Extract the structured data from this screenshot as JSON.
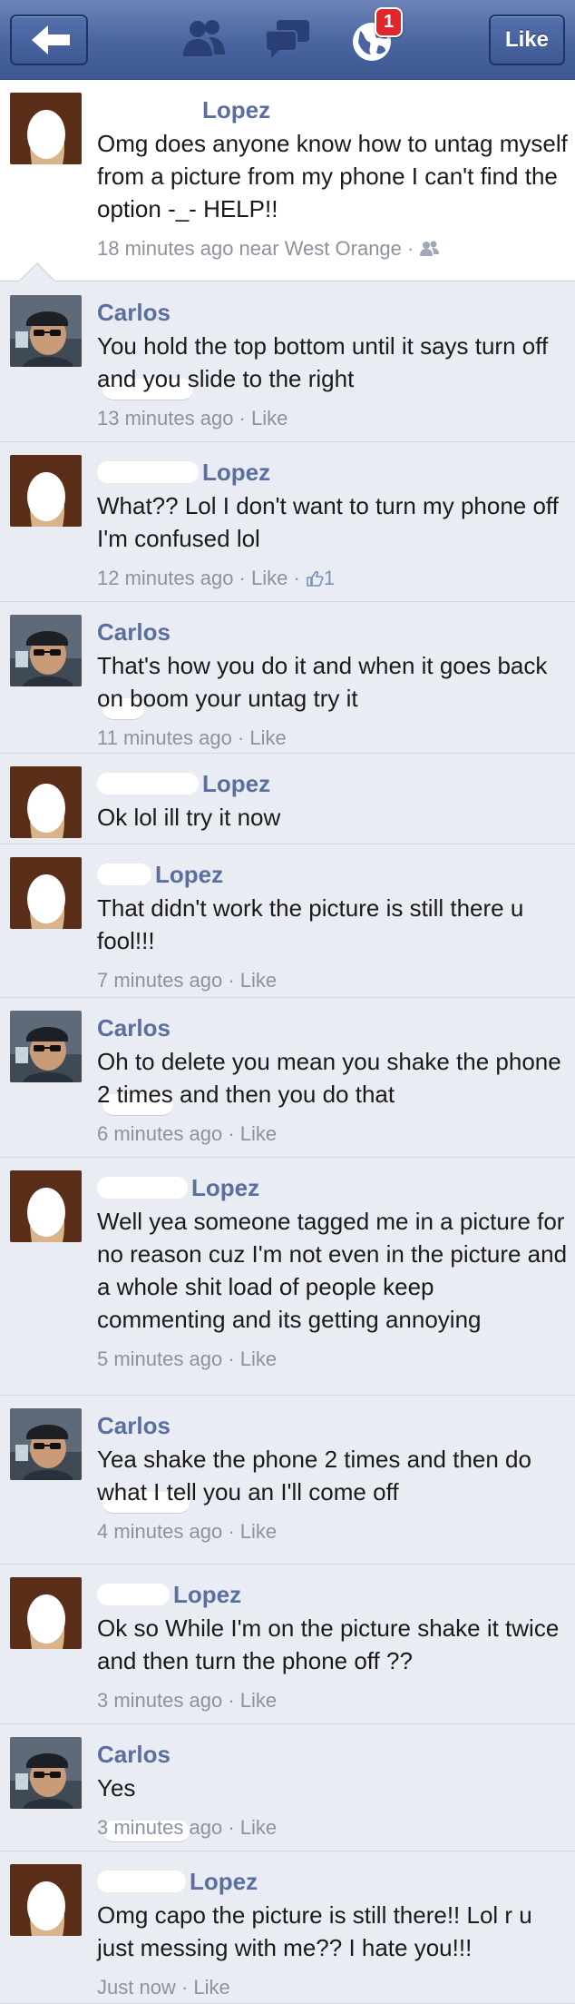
{
  "topbar": {
    "like_label": "Like",
    "notification_count": "1",
    "colors": {
      "bar": "#4a64a0",
      "badge": "#e0262b"
    }
  },
  "post": {
    "author_surname": "Lopez",
    "text": "Omg does anyone know how to untag myself from a picture from my phone I can't find the option -_- HELP!!",
    "time": "18 minutes ago near West Orange"
  },
  "comments": [
    {
      "author": "Carlos",
      "text": "You hold the top bottom until it says turn off and you slide to the right",
      "time": "13 minutes ago",
      "like": "Like"
    },
    {
      "author": "Lopez",
      "text": "What?? Lol I don't want to turn my phone off I'm confused lol",
      "time": "12 minutes ago",
      "like": "Like",
      "likes": "1"
    },
    {
      "author": "Carlos",
      "text": "That's how you do it and when it goes back on boom your untag try it",
      "time": "11 minutes ago",
      "like": "Like"
    },
    {
      "author": "Lopez",
      "text": "Ok lol ill try it now"
    },
    {
      "author": "Lopez",
      "text": "That didn't work the picture is still there u fool!!!",
      "time": "7 minutes ago",
      "like": "Like"
    },
    {
      "author": "Carlos",
      "text": "Oh to delete you mean you shake the phone 2 times and then you do that",
      "time": "6 minutes ago",
      "like": "Like"
    },
    {
      "author": "Lopez",
      "text": "Well yea someone tagged me in a picture for no reason cuz I'm not even in the picture and a whole shit load of people keep commenting and its getting annoying",
      "time": "5 minutes ago",
      "like": "Like"
    },
    {
      "author": "Carlos",
      "text": "Yea shake the phone 2 times and then do what I tell you an I'll come off",
      "time": "4 minutes ago",
      "like": "Like"
    },
    {
      "author": "Lopez",
      "text": "Ok so While I'm on the picture shake it twice and then turn the phone off ??",
      "time": "3 minutes ago",
      "like": "Like"
    },
    {
      "author": "Carlos",
      "text": "Yes",
      "time": "3 minutes ago",
      "like": "Like"
    },
    {
      "author": "Lopez",
      "text": "Omg capo the picture is still there!! Lol r u just messing with me?? I hate you!!!",
      "time": "Just now",
      "like": "Like"
    }
  ]
}
